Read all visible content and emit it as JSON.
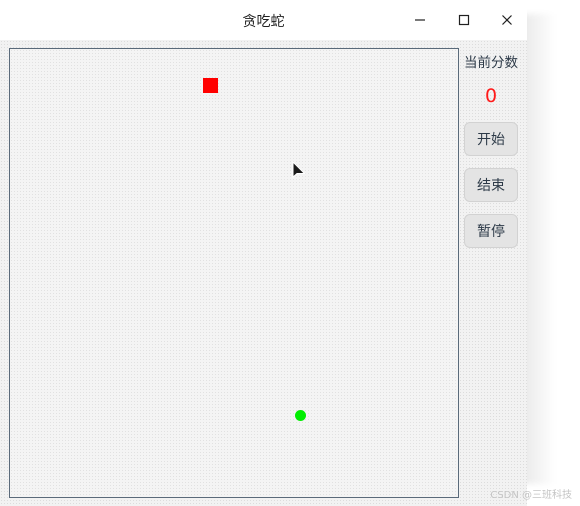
{
  "window": {
    "title": "贪吃蛇",
    "controls": [
      "minimize-icon",
      "maximize-icon",
      "close-icon"
    ]
  },
  "game": {
    "food_color": "#ff0000",
    "snake_head_color": "#00ee00",
    "border_color": "#5a6a7a"
  },
  "sidebar": {
    "score_label": "当前分数",
    "score_value": "0",
    "score_color": "#ff1a1a",
    "buttons": {
      "start": "开始",
      "end": "结束",
      "pause": "暂停"
    }
  },
  "watermark": "CSDN @三班科技"
}
